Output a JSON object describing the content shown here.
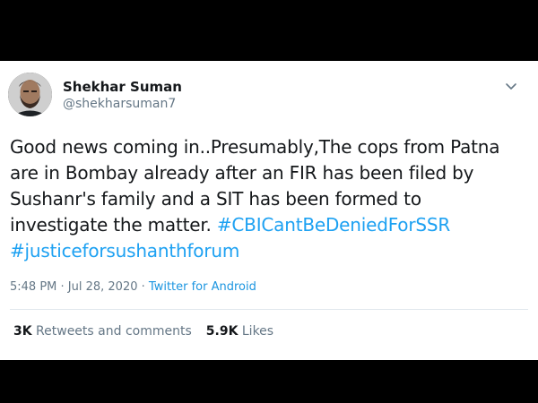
{
  "tweet": {
    "author": {
      "name": "Shekhar Suman",
      "handle": "@shekharsuman7"
    },
    "text_lines": [
      "Good news coming in..Presumably,The cops from Patna",
      "are in Bombay already after an FIR has been filed by",
      "Sushanr's family and a SIT has been formed to",
      "investigate the matter. "
    ],
    "hashtags": [
      "#CBICantBeDeniedForSSR",
      "#justiceforsushanthforum"
    ],
    "timestamp": "5:48 PM · Jul 28, 2020",
    "separator": " · ",
    "source": "Twitter for Android",
    "stats": {
      "retweets_count": "3K",
      "retweets_label": "Retweets and comments",
      "likes_count": "5.9K",
      "likes_label": "Likes"
    }
  },
  "icons": {
    "more": "chevron-down-icon",
    "avatar": "profile-photo"
  },
  "colors": {
    "link": "#1da1f2",
    "text": "#14171a",
    "muted": "#657786",
    "background": "#ffffff",
    "letterbox": "#000000"
  }
}
